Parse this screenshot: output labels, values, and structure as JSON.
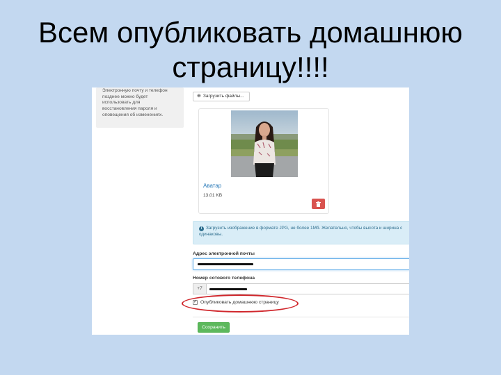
{
  "slide": {
    "title_line1": "Всем опубликовать домашнюю",
    "title_line2": "страницу!!!!"
  },
  "form": {
    "side_note_lines": [
      "Электронную почту и телефон",
      "позднее можно будет",
      "использовать для",
      "восстановления пароля и",
      "оповещения об изменениях."
    ],
    "upload_button": "Загрузить файлы...",
    "avatar": {
      "link_label": "Аватар",
      "file_size": "13,01 KB"
    },
    "info_alert": {
      "line1": "Загрузить изображение в формате JPG, не более 1Мб. Желательно, чтобы высота и ширина с",
      "line2": "одинаковы."
    },
    "email_label": "Адрес электронной почты",
    "phone_label": "Номер сотового телефона",
    "phone_prefix": "+7",
    "publish_checkbox": {
      "label": "Опубликовать домашнюю страницу",
      "checked": true
    },
    "save_button": "Сохранить"
  },
  "colors": {
    "slide_background": "#c3d8f0",
    "highlight_ellipse": "#d0262b",
    "save_button": "#5cb85c",
    "delete_button": "#d9534f",
    "link": "#2a7ab8",
    "info_alert_bg": "#d9edf7"
  },
  "icons": {
    "upload": "upload-icon",
    "delete": "trash-icon",
    "info": "info-icon",
    "checkbox": "checkmark-icon"
  }
}
